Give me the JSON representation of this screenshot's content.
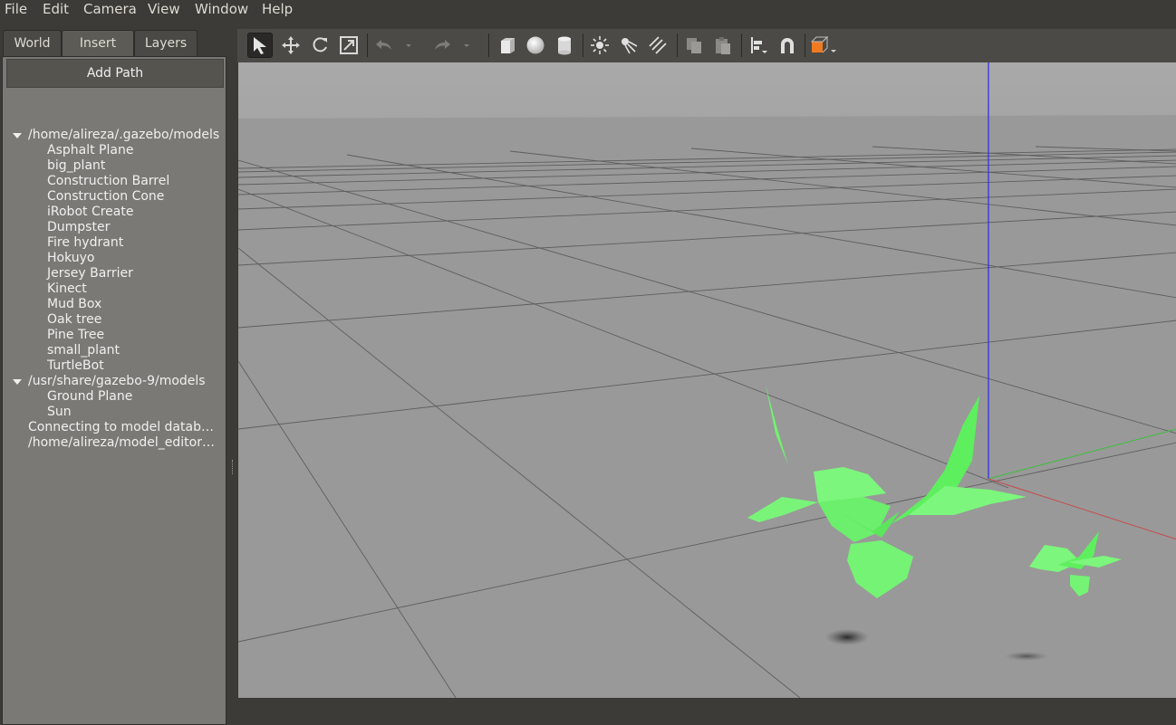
{
  "menu": {
    "file": "File",
    "edit": "Edit",
    "camera": "Camera",
    "view": "View",
    "window": "Window",
    "help": "Help"
  },
  "tabs": {
    "world": "World",
    "insert": "Insert",
    "layers": "Layers",
    "active": "Insert"
  },
  "insert_panel": {
    "add_path_label": "Add Path",
    "groups": [
      {
        "path": "/home/alireza/.gazebo/models",
        "items": [
          "Asphalt Plane",
          "big_plant",
          "Construction Barrel",
          "Construction Cone",
          "iRobot Create",
          "Dumpster",
          "Fire hydrant",
          "Hokuyo",
          "Jersey Barrier",
          "Kinect",
          "Mud Box",
          "Oak tree",
          "Pine Tree",
          "small_plant",
          "TurtleBot"
        ]
      },
      {
        "path": "/usr/share/gazebo-9/models",
        "items": [
          "Ground Plane",
          "Sun"
        ]
      }
    ],
    "extra": [
      "Connecting to model databa…",
      "/home/alireza/model_editor…"
    ]
  },
  "toolbar": {
    "tools": [
      "select-mode",
      "translate-mode",
      "rotate-mode",
      "scale-mode",
      "undo",
      "undo-history",
      "redo",
      "redo-history",
      "box",
      "sphere",
      "cylinder",
      "point-light",
      "spot-light",
      "directional-light",
      "copy",
      "paste",
      "align",
      "snap",
      "change-view"
    ],
    "active_tool": "select-mode"
  },
  "scene": {
    "models": [
      "big_plant",
      "small_plant"
    ],
    "colors": {
      "sky": "#a8a8a8",
      "ground": "#999999",
      "grid": "#5f5f5f",
      "plant": "#6ef56e",
      "z_axis": "#2222ff",
      "x_axis": "#d04a4a",
      "y_axis": "#3ad23a",
      "view_cube": "#f07a20"
    }
  }
}
